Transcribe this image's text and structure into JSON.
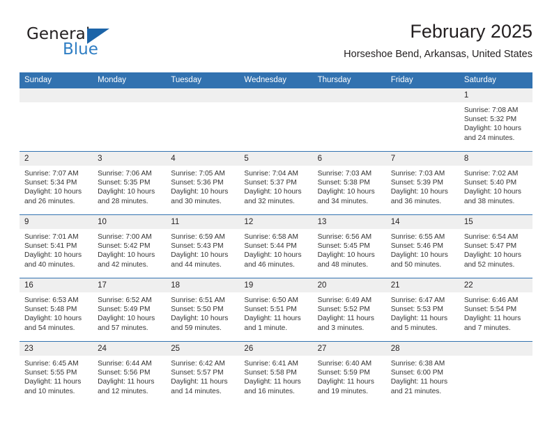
{
  "logo": {
    "word_one": "General",
    "word_two": "Blue",
    "triangle_color": "#1c64a8",
    "blue_text_color": "#2f7ec4"
  },
  "header": {
    "title": "February 2025",
    "subtitle": "Horseshoe Bend, Arkansas, United States"
  },
  "theme": {
    "header_blue": "#3272b0",
    "daynum_band": "#efefef",
    "text": "#231f20"
  },
  "weekdays": [
    "Sunday",
    "Monday",
    "Tuesday",
    "Wednesday",
    "Thursday",
    "Friday",
    "Saturday"
  ],
  "weeks": [
    [
      {
        "day": "",
        "sunrise": "",
        "sunset": "",
        "daylight_line1": "",
        "daylight_line2": ""
      },
      {
        "day": "",
        "sunrise": "",
        "sunset": "",
        "daylight_line1": "",
        "daylight_line2": ""
      },
      {
        "day": "",
        "sunrise": "",
        "sunset": "",
        "daylight_line1": "",
        "daylight_line2": ""
      },
      {
        "day": "",
        "sunrise": "",
        "sunset": "",
        "daylight_line1": "",
        "daylight_line2": ""
      },
      {
        "day": "",
        "sunrise": "",
        "sunset": "",
        "daylight_line1": "",
        "daylight_line2": ""
      },
      {
        "day": "",
        "sunrise": "",
        "sunset": "",
        "daylight_line1": "",
        "daylight_line2": ""
      },
      {
        "day": "1",
        "sunrise": "Sunrise: 7:08 AM",
        "sunset": "Sunset: 5:32 PM",
        "daylight_line1": "Daylight: 10 hours",
        "daylight_line2": "and 24 minutes."
      }
    ],
    [
      {
        "day": "2",
        "sunrise": "Sunrise: 7:07 AM",
        "sunset": "Sunset: 5:34 PM",
        "daylight_line1": "Daylight: 10 hours",
        "daylight_line2": "and 26 minutes."
      },
      {
        "day": "3",
        "sunrise": "Sunrise: 7:06 AM",
        "sunset": "Sunset: 5:35 PM",
        "daylight_line1": "Daylight: 10 hours",
        "daylight_line2": "and 28 minutes."
      },
      {
        "day": "4",
        "sunrise": "Sunrise: 7:05 AM",
        "sunset": "Sunset: 5:36 PM",
        "daylight_line1": "Daylight: 10 hours",
        "daylight_line2": "and 30 minutes."
      },
      {
        "day": "5",
        "sunrise": "Sunrise: 7:04 AM",
        "sunset": "Sunset: 5:37 PM",
        "daylight_line1": "Daylight: 10 hours",
        "daylight_line2": "and 32 minutes."
      },
      {
        "day": "6",
        "sunrise": "Sunrise: 7:03 AM",
        "sunset": "Sunset: 5:38 PM",
        "daylight_line1": "Daylight: 10 hours",
        "daylight_line2": "and 34 minutes."
      },
      {
        "day": "7",
        "sunrise": "Sunrise: 7:03 AM",
        "sunset": "Sunset: 5:39 PM",
        "daylight_line1": "Daylight: 10 hours",
        "daylight_line2": "and 36 minutes."
      },
      {
        "day": "8",
        "sunrise": "Sunrise: 7:02 AM",
        "sunset": "Sunset: 5:40 PM",
        "daylight_line1": "Daylight: 10 hours",
        "daylight_line2": "and 38 minutes."
      }
    ],
    [
      {
        "day": "9",
        "sunrise": "Sunrise: 7:01 AM",
        "sunset": "Sunset: 5:41 PM",
        "daylight_line1": "Daylight: 10 hours",
        "daylight_line2": "and 40 minutes."
      },
      {
        "day": "10",
        "sunrise": "Sunrise: 7:00 AM",
        "sunset": "Sunset: 5:42 PM",
        "daylight_line1": "Daylight: 10 hours",
        "daylight_line2": "and 42 minutes."
      },
      {
        "day": "11",
        "sunrise": "Sunrise: 6:59 AM",
        "sunset": "Sunset: 5:43 PM",
        "daylight_line1": "Daylight: 10 hours",
        "daylight_line2": "and 44 minutes."
      },
      {
        "day": "12",
        "sunrise": "Sunrise: 6:58 AM",
        "sunset": "Sunset: 5:44 PM",
        "daylight_line1": "Daylight: 10 hours",
        "daylight_line2": "and 46 minutes."
      },
      {
        "day": "13",
        "sunrise": "Sunrise: 6:56 AM",
        "sunset": "Sunset: 5:45 PM",
        "daylight_line1": "Daylight: 10 hours",
        "daylight_line2": "and 48 minutes."
      },
      {
        "day": "14",
        "sunrise": "Sunrise: 6:55 AM",
        "sunset": "Sunset: 5:46 PM",
        "daylight_line1": "Daylight: 10 hours",
        "daylight_line2": "and 50 minutes."
      },
      {
        "day": "15",
        "sunrise": "Sunrise: 6:54 AM",
        "sunset": "Sunset: 5:47 PM",
        "daylight_line1": "Daylight: 10 hours",
        "daylight_line2": "and 52 minutes."
      }
    ],
    [
      {
        "day": "16",
        "sunrise": "Sunrise: 6:53 AM",
        "sunset": "Sunset: 5:48 PM",
        "daylight_line1": "Daylight: 10 hours",
        "daylight_line2": "and 54 minutes."
      },
      {
        "day": "17",
        "sunrise": "Sunrise: 6:52 AM",
        "sunset": "Sunset: 5:49 PM",
        "daylight_line1": "Daylight: 10 hours",
        "daylight_line2": "and 57 minutes."
      },
      {
        "day": "18",
        "sunrise": "Sunrise: 6:51 AM",
        "sunset": "Sunset: 5:50 PM",
        "daylight_line1": "Daylight: 10 hours",
        "daylight_line2": "and 59 minutes."
      },
      {
        "day": "19",
        "sunrise": "Sunrise: 6:50 AM",
        "sunset": "Sunset: 5:51 PM",
        "daylight_line1": "Daylight: 11 hours",
        "daylight_line2": "and 1 minute."
      },
      {
        "day": "20",
        "sunrise": "Sunrise: 6:49 AM",
        "sunset": "Sunset: 5:52 PM",
        "daylight_line1": "Daylight: 11 hours",
        "daylight_line2": "and 3 minutes."
      },
      {
        "day": "21",
        "sunrise": "Sunrise: 6:47 AM",
        "sunset": "Sunset: 5:53 PM",
        "daylight_line1": "Daylight: 11 hours",
        "daylight_line2": "and 5 minutes."
      },
      {
        "day": "22",
        "sunrise": "Sunrise: 6:46 AM",
        "sunset": "Sunset: 5:54 PM",
        "daylight_line1": "Daylight: 11 hours",
        "daylight_line2": "and 7 minutes."
      }
    ],
    [
      {
        "day": "23",
        "sunrise": "Sunrise: 6:45 AM",
        "sunset": "Sunset: 5:55 PM",
        "daylight_line1": "Daylight: 11 hours",
        "daylight_line2": "and 10 minutes."
      },
      {
        "day": "24",
        "sunrise": "Sunrise: 6:44 AM",
        "sunset": "Sunset: 5:56 PM",
        "daylight_line1": "Daylight: 11 hours",
        "daylight_line2": "and 12 minutes."
      },
      {
        "day": "25",
        "sunrise": "Sunrise: 6:42 AM",
        "sunset": "Sunset: 5:57 PM",
        "daylight_line1": "Daylight: 11 hours",
        "daylight_line2": "and 14 minutes."
      },
      {
        "day": "26",
        "sunrise": "Sunrise: 6:41 AM",
        "sunset": "Sunset: 5:58 PM",
        "daylight_line1": "Daylight: 11 hours",
        "daylight_line2": "and 16 minutes."
      },
      {
        "day": "27",
        "sunrise": "Sunrise: 6:40 AM",
        "sunset": "Sunset: 5:59 PM",
        "daylight_line1": "Daylight: 11 hours",
        "daylight_line2": "and 19 minutes."
      },
      {
        "day": "28",
        "sunrise": "Sunrise: 6:38 AM",
        "sunset": "Sunset: 6:00 PM",
        "daylight_line1": "Daylight: 11 hours",
        "daylight_line2": "and 21 minutes."
      },
      {
        "day": "",
        "sunrise": "",
        "sunset": "",
        "daylight_line1": "",
        "daylight_line2": ""
      }
    ]
  ]
}
